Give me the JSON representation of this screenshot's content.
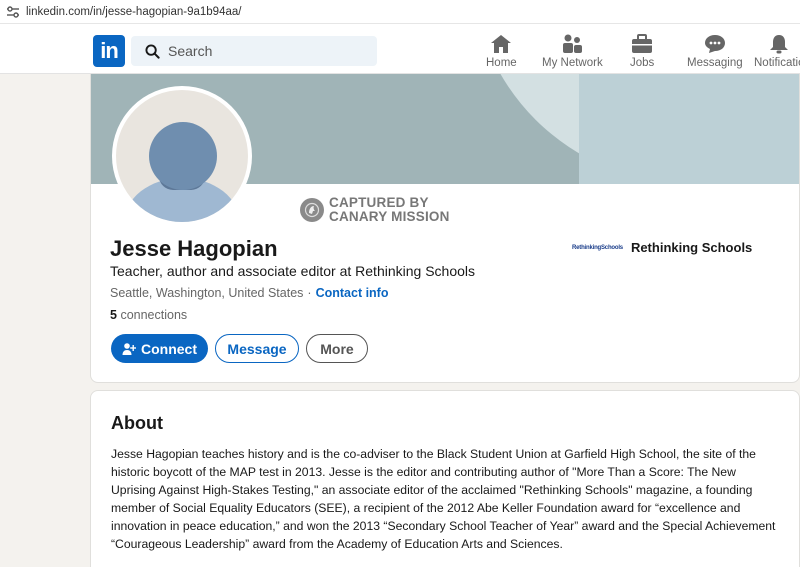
{
  "browser": {
    "url": "linkedin.com/in/jesse-hagopian-9a1b94aa/"
  },
  "nav": {
    "logo": "in",
    "search_placeholder": "Search",
    "items": [
      {
        "label": "Home",
        "icon": "home-icon"
      },
      {
        "label": "My Network",
        "icon": "network-icon"
      },
      {
        "label": "Jobs",
        "icon": "briefcase-icon"
      },
      {
        "label": "Messaging",
        "icon": "messaging-icon"
      },
      {
        "label": "Notificatio",
        "icon": "bell-icon"
      }
    ]
  },
  "profile": {
    "stamp_line1": "CAPTURED BY",
    "stamp_line2": "CANARY MISSION",
    "name": "Jesse Hagopian",
    "headline": "Teacher, author and associate editor at Rethinking Schools",
    "location": "Seattle, Washington, United States",
    "separator": "·",
    "contact_info": "Contact info",
    "connections_count": "5",
    "connections_label": "connections",
    "company_logo_text": "RethinkingSchools",
    "company_name": "Rethinking Schools",
    "buttons": {
      "connect": "Connect",
      "message": "Message",
      "more": "More"
    }
  },
  "about": {
    "title": "About",
    "text": "Jesse Hagopian teaches history and is the co-adviser to the Black Student Union at Garfield High School, the site of the historic boycott of the MAP test in 2013. Jesse is the editor and contributing author of \"More Than a Score: The New Uprising Against High-Stakes Testing,\" an associate editor of the acclaimed \"Rethinking Schools\" magazine, a founding member of Social Equality Educators (SEE), a recipient of the 2012 Abe Keller Foundation award for “excellence and innovation in peace education,” and won the 2013 “Secondary School Teacher of Year” award and the Special Achievement “Courageous Leadership” award from the Academy of Education Arts and Sciences."
  },
  "colors": {
    "brand": "#0a66c2",
    "banner": "#a0b4b7"
  }
}
